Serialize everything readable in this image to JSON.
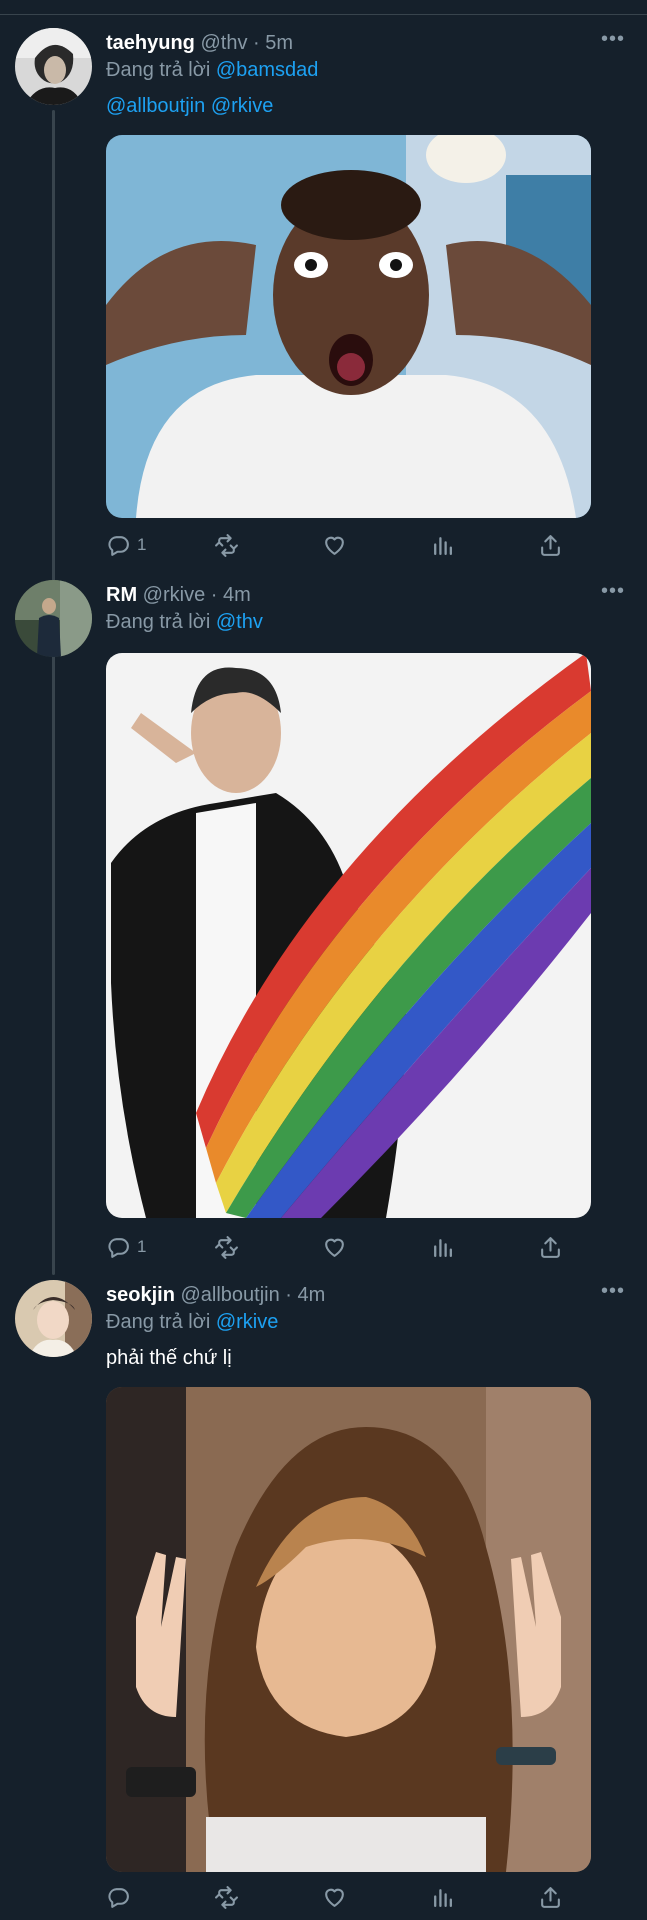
{
  "tweets": [
    {
      "name": "taehyung",
      "handle": "@thv",
      "time": "5m",
      "reply_prefix": "Đang trả lời",
      "reply_to": "@bamsdad",
      "mentions": [
        "@allboutjin",
        "@rkive"
      ],
      "text": "",
      "replies": "1",
      "more": "•••"
    },
    {
      "name": "RM",
      "handle": "@rkive",
      "time": "4m",
      "reply_prefix": "Đang trả lời",
      "reply_to": "@thv",
      "text": "",
      "replies": "1",
      "more": "•••"
    },
    {
      "name": "seokjin",
      "handle": "@allboutjin",
      "time": "4m",
      "reply_prefix": "Đang trả lời",
      "reply_to": "@rkive",
      "text": "phải thế chứ lị",
      "replies": "",
      "more": "•••"
    }
  ],
  "separator": "·",
  "icons": {
    "reply": "reply-icon",
    "retweet": "retweet-icon",
    "like": "heart-icon",
    "analytics": "analytics-icon",
    "share": "share-icon",
    "more": "more-icon"
  },
  "colors": {
    "background": "#15202b",
    "secondary_text": "#8899a6",
    "link": "#1da1f2",
    "divider": "#38444d"
  }
}
